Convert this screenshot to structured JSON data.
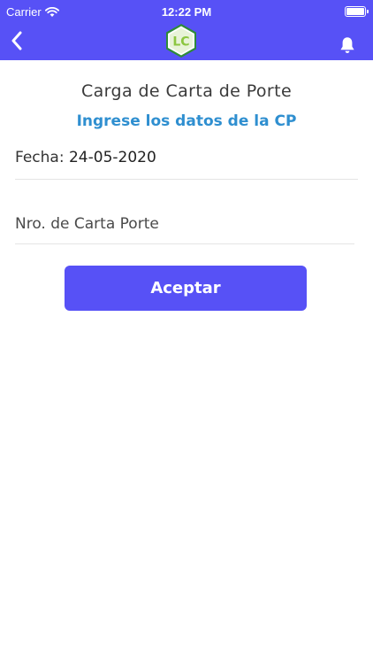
{
  "status_bar": {
    "carrier": "Carrier",
    "time": "12:22 PM"
  },
  "nav": {
    "logo_text": "LC",
    "icons": [
      "chevron-left-icon",
      "wifi-icon",
      "battery-icon",
      "bell-icon"
    ]
  },
  "page": {
    "title": "Carga de Carta de Porte",
    "subtitle": "Ingrese los datos de la CP"
  },
  "form": {
    "date_label": "Fecha:",
    "date_value": "24-05-2020",
    "cp_value": "",
    "cp_placeholder": "Nro. de Carta Porte",
    "accept_label": "Aceptar"
  },
  "colors": {
    "primary": "#5751f6",
    "subtitle": "#2f8fd0",
    "logo_green": "#8cc640",
    "logo_border": "#2e8a3a"
  }
}
